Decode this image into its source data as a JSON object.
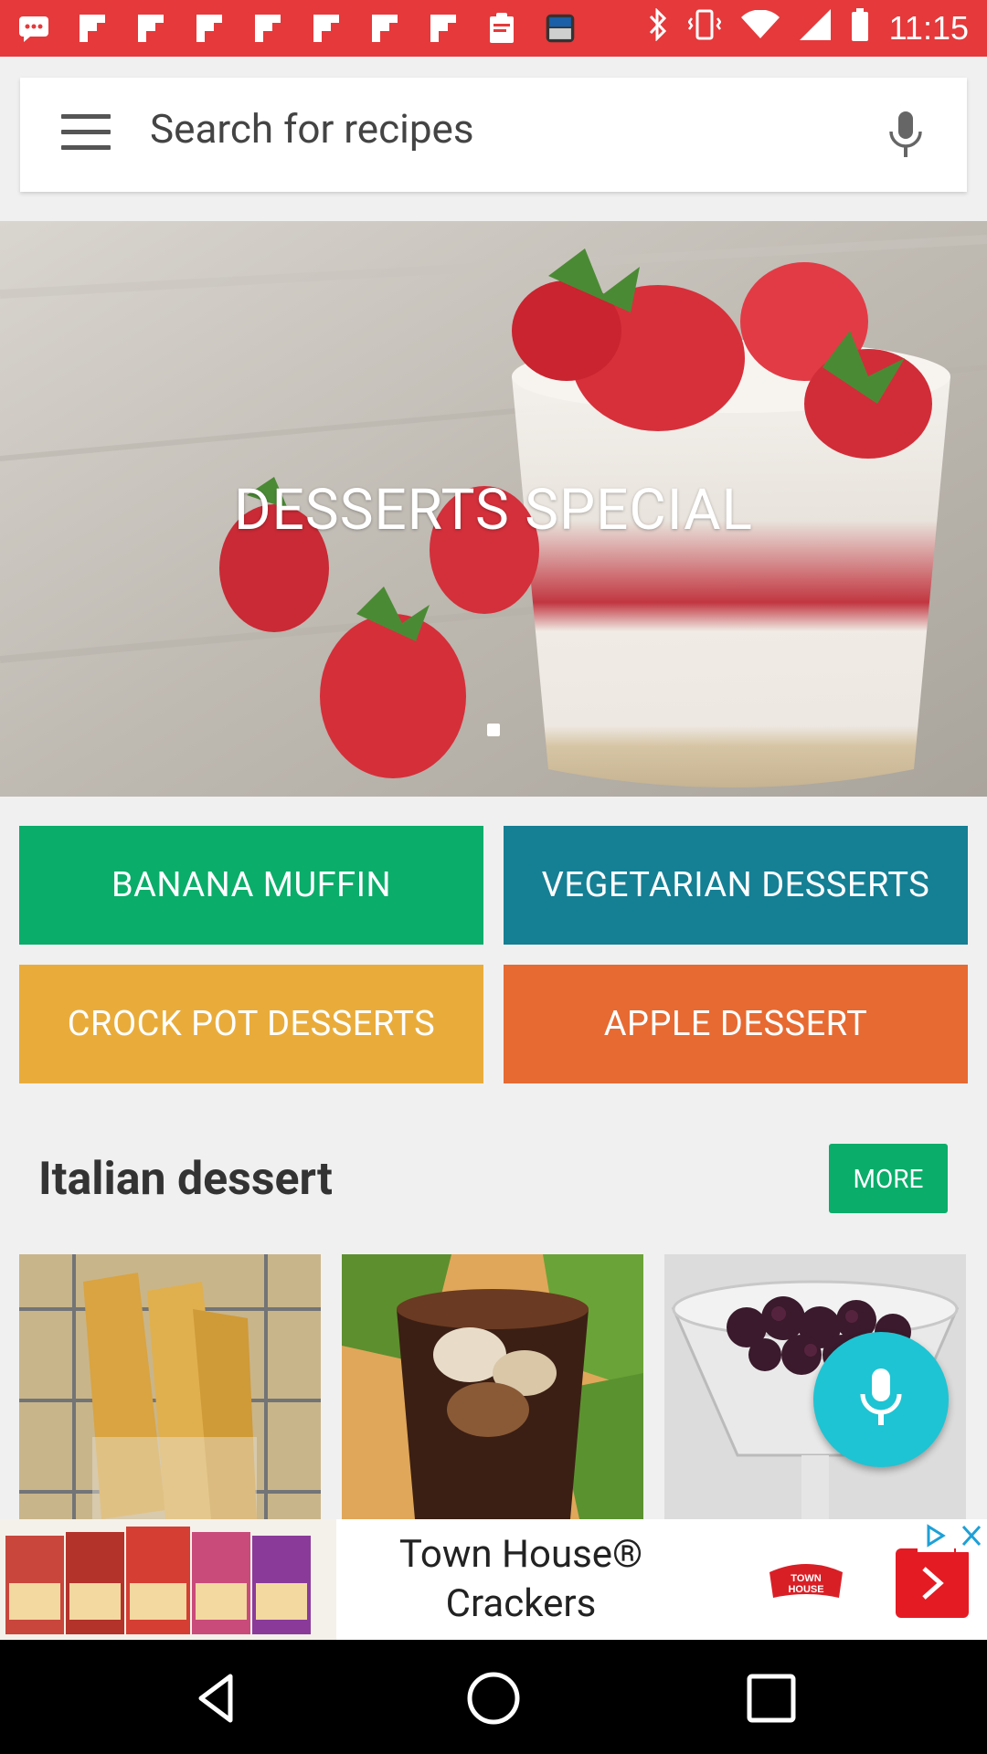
{
  "status_bar": {
    "time": "11:15",
    "left_icons": [
      "message-icon",
      "flipboard-icon",
      "flipboard-icon",
      "flipboard-icon",
      "flipboard-icon",
      "flipboard-icon",
      "flipboard-icon",
      "flipboard-icon",
      "clipboard-icon",
      "news-app-icon"
    ],
    "right_icons": [
      "bluetooth-icon",
      "vibrate-icon",
      "wifi-icon",
      "signal-icon",
      "battery-icon"
    ],
    "color": "#e5393b"
  },
  "search": {
    "placeholder": "Search for recipes"
  },
  "hero": {
    "title": "DESSERTS SPECIAL"
  },
  "categories": [
    {
      "label": "BANANA MUFFIN",
      "color": "#0aad6a"
    },
    {
      "label": "VEGETARIAN DESSERTS",
      "color": "#157f94"
    },
    {
      "label": "CROCK POT DESSERTS",
      "color": "#e9ac3b"
    },
    {
      "label": "APPLE DESSERT",
      "color": "#e76a32"
    }
  ],
  "section": {
    "title": "Italian dessert",
    "more_label": "MORE"
  },
  "ad": {
    "headline_line1": "Town House®",
    "headline_line2": "Crackers",
    "brand_line1": "TOWN",
    "brand_line2": "HOUSE"
  }
}
